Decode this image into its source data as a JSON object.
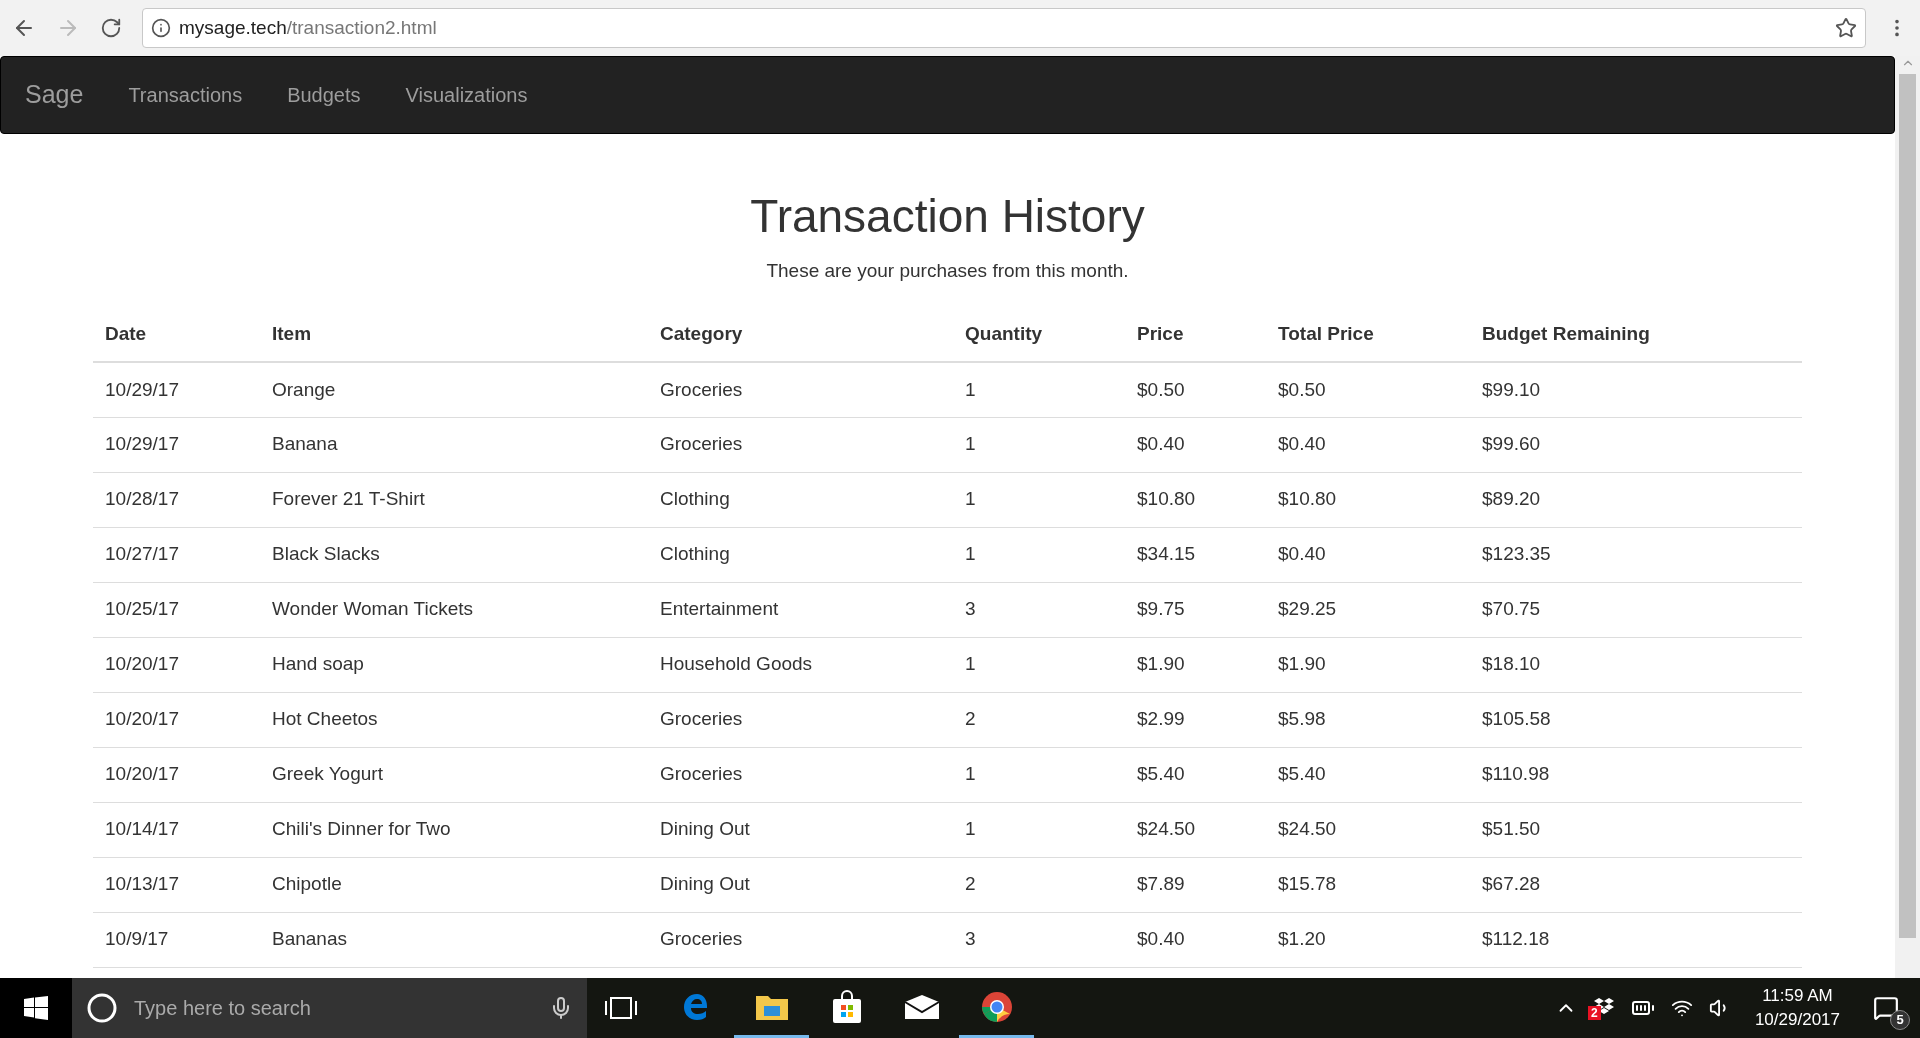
{
  "browser": {
    "url_host": "mysage.tech",
    "url_path": "/transaction2.html"
  },
  "navbar": {
    "brand": "Sage",
    "links": [
      "Transactions",
      "Budgets",
      "Visualizations"
    ]
  },
  "page": {
    "title": "Transaction History",
    "subtitle": "These are your purchases from this month."
  },
  "table": {
    "columns": [
      "Date",
      "Item",
      "Category",
      "Quantity",
      "Price",
      "Total Price",
      "Budget Remaining"
    ],
    "rows": [
      [
        "10/29/17",
        "Orange",
        "Groceries",
        "1",
        "$0.50",
        "$0.50",
        "$99.10"
      ],
      [
        "10/29/17",
        "Banana",
        "Groceries",
        "1",
        "$0.40",
        "$0.40",
        "$99.60"
      ],
      [
        "10/28/17",
        "Forever 21 T-Shirt",
        "Clothing",
        "1",
        "$10.80",
        "$10.80",
        "$89.20"
      ],
      [
        "10/27/17",
        "Black Slacks",
        "Clothing",
        "1",
        "$34.15",
        "$0.40",
        "$123.35"
      ],
      [
        "10/25/17",
        "Wonder Woman Tickets",
        "Entertainment",
        "3",
        "$9.75",
        "$29.25",
        "$70.75"
      ],
      [
        "10/20/17",
        "Hand soap",
        "Household Goods",
        "1",
        "$1.90",
        "$1.90",
        "$18.10"
      ],
      [
        "10/20/17",
        "Hot Cheetos",
        "Groceries",
        "2",
        "$2.99",
        "$5.98",
        "$105.58"
      ],
      [
        "10/20/17",
        "Greek Yogurt",
        "Groceries",
        "1",
        "$5.40",
        "$5.40",
        "$110.98"
      ],
      [
        "10/14/17",
        "Chili's Dinner for Two",
        "Dining Out",
        "1",
        "$24.50",
        "$24.50",
        "$51.50"
      ],
      [
        "10/13/17",
        "Chipotle",
        "Dining Out",
        "2",
        "$7.89",
        "$15.78",
        "$67.28"
      ],
      [
        "10/9/17",
        "Bananas",
        "Groceries",
        "3",
        "$0.40",
        "$1.20",
        "$112.18"
      ]
    ]
  },
  "taskbar": {
    "search_placeholder": "Type here to search",
    "apps": [
      {
        "kind": "edge",
        "running": false
      },
      {
        "kind": "folder",
        "running": true
      },
      {
        "kind": "store",
        "running": false
      },
      {
        "kind": "mail",
        "running": false
      },
      {
        "kind": "chrome",
        "running": true
      }
    ],
    "dropbox_badge": "2",
    "time": "11:59 AM",
    "date": "10/29/2017",
    "notifications": "5"
  }
}
